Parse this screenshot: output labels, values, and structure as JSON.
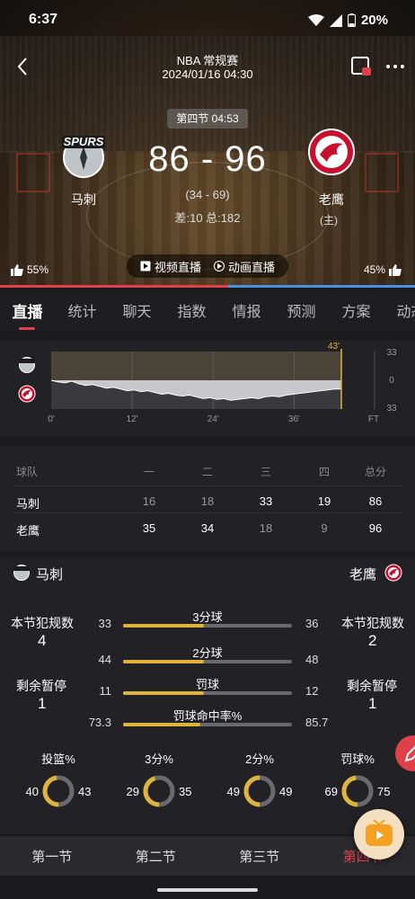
{
  "status": {
    "time": "6:37",
    "battery": "20%"
  },
  "header": {
    "league": "NBA 常规赛",
    "datetime": "2024/01/16 04:30"
  },
  "game": {
    "period_clock": "第四节 04:53",
    "score": "86 - 96",
    "half_score": "(34 - 69)",
    "diff_total": "差:10 总:182",
    "home_tag": "(主)"
  },
  "teams": {
    "away": {
      "name": "马刺",
      "logo_text": "SPURS",
      "like_pct": "55%"
    },
    "home": {
      "name": "老鹰",
      "like_pct": "45%"
    }
  },
  "live_buttons": {
    "video": "视频直播",
    "animation": "动画直播"
  },
  "tabs": [
    "直播",
    "统计",
    "聊天",
    "指数",
    "情报",
    "预测",
    "方案",
    "动态"
  ],
  "trend": {
    "x_ticks": [
      "0'",
      "12'",
      "24'",
      "36'",
      "FT"
    ],
    "y_ticks": [
      "33",
      "0",
      "33"
    ],
    "marker": "43'",
    "series": [
      0,
      -2,
      -3,
      -1,
      -4,
      -6,
      -5,
      -7,
      -9,
      -8,
      -10,
      -12,
      -11,
      -13,
      -12,
      -14,
      -16,
      -15,
      -17,
      -18,
      -17,
      -19,
      -21,
      -20,
      -22,
      -21,
      -23,
      -22,
      -21,
      -20,
      -21,
      -19,
      -18,
      -19,
      -17,
      -16,
      -15,
      -14,
      -13,
      -12,
      -11,
      -10,
      -10
    ]
  },
  "quarter_table": {
    "headers": [
      "球队",
      "一",
      "二",
      "三",
      "四",
      "总分"
    ],
    "rows": [
      {
        "team": "马刺",
        "q": [
          "16",
          "18",
          "33",
          "19",
          "86"
        ]
      },
      {
        "team": "老鹰",
        "q": [
          "35",
          "34",
          "18",
          "9",
          "96"
        ]
      }
    ]
  },
  "stats": {
    "away_name": "马刺",
    "home_name": "老鹰",
    "fouls_label": "本节犯规数",
    "away_fouls": "4",
    "home_fouls": "2",
    "timeouts_label": "剩余暂停",
    "away_timeouts": "1",
    "home_timeouts": "1",
    "bars": [
      {
        "label": "3分球",
        "away": "33",
        "home": "36",
        "away_frac": 0.48
      },
      {
        "label": "2分球",
        "away": "44",
        "home": "48",
        "away_frac": 0.48
      },
      {
        "label": "罚球",
        "away": "11",
        "home": "12",
        "away_frac": 0.48
      },
      {
        "label": "罚球命中率%",
        "away": "73.3",
        "home": "85.7",
        "away_frac": 0.46
      }
    ],
    "rings": [
      {
        "label": "投篮%",
        "away": "40",
        "home": "43",
        "away_frac": 0.48
      },
      {
        "label": "3分%",
        "away": "29",
        "home": "35",
        "away_frac": 0.45
      },
      {
        "label": "2分%",
        "away": "49",
        "home": "49",
        "away_frac": 0.5
      },
      {
        "label": "罚球%",
        "away": "69",
        "home": "75",
        "away_frac": 0.48
      }
    ]
  },
  "quarter_tabs": [
    "第一节",
    "第二节",
    "第三节",
    "第四节"
  ],
  "colors": {
    "accent": "#e0404a",
    "away": "#e0404a",
    "home": "#4a90e2",
    "bar_fill": "#e0b43a"
  }
}
